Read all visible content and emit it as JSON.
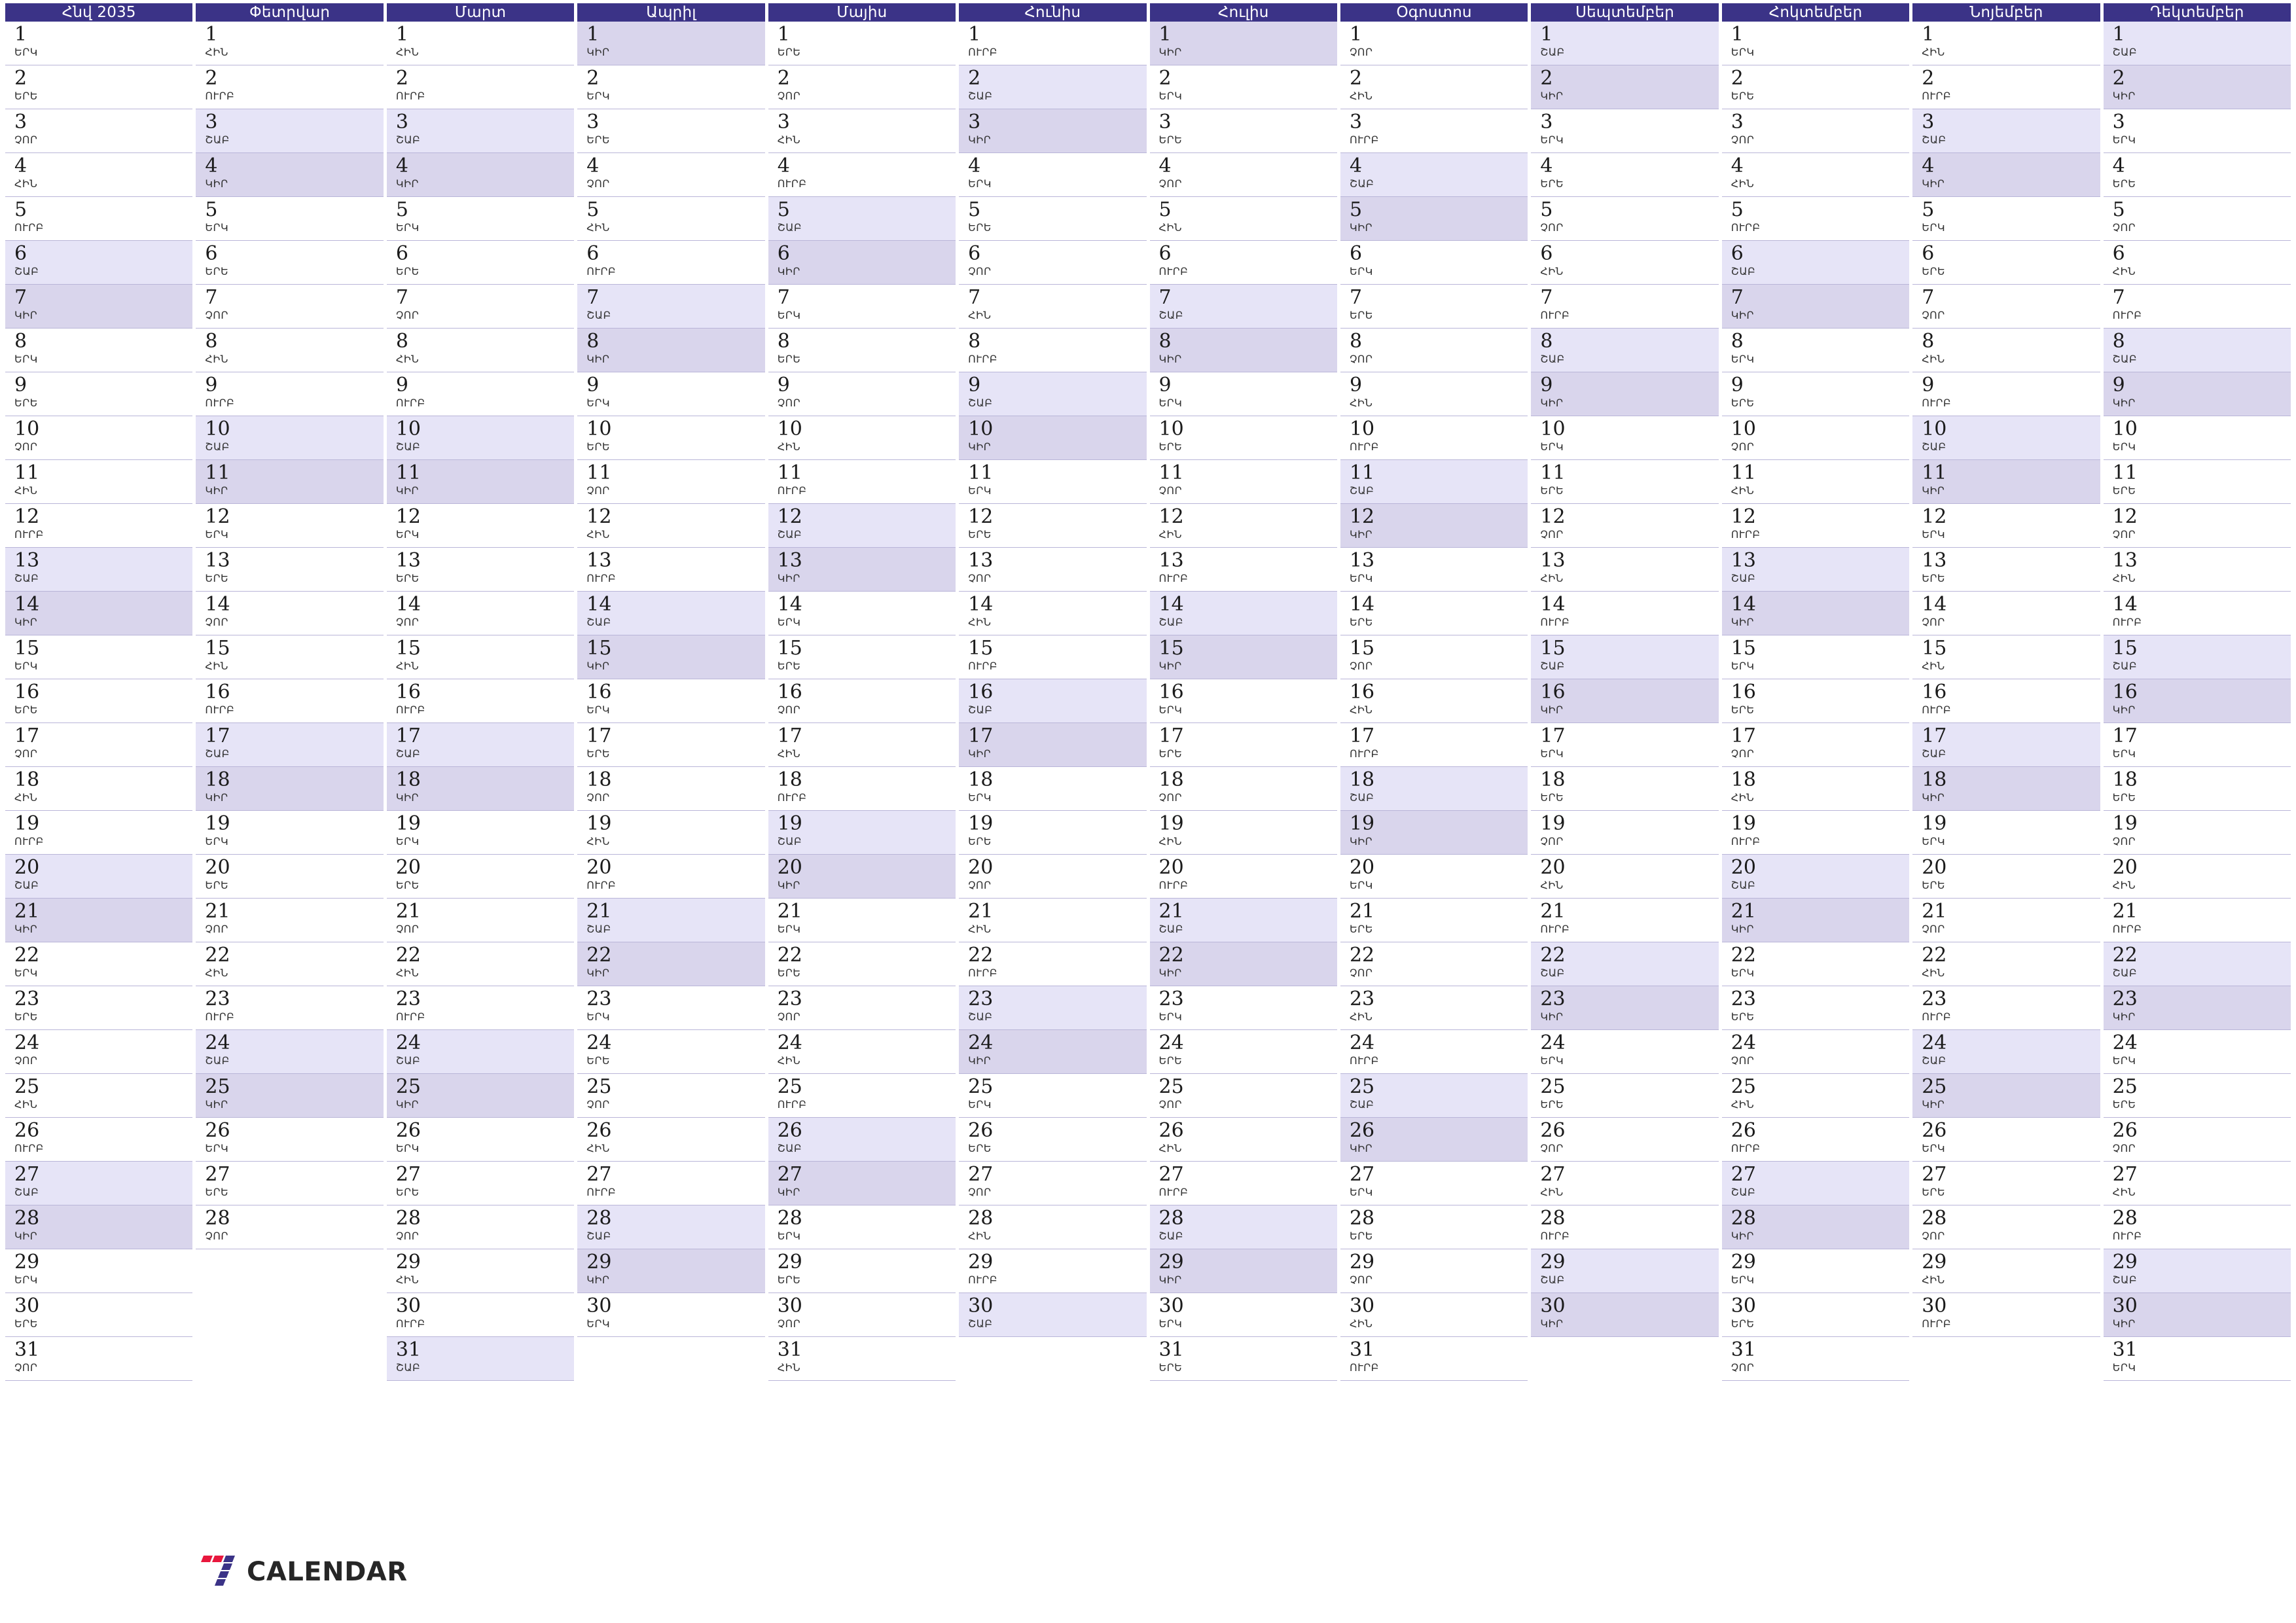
{
  "calendar": {
    "year": "2035",
    "title_first_month": "Հնվ 2035",
    "weekday_abbr": {
      "mon": "ԵՐԿ",
      "tue": "ԵՐԵ",
      "wed": "ՉՈՐ",
      "thu": "ՀԻՆ",
      "fri": "ՈՒՐԲ",
      "sat": "ՇԱԲ",
      "sun": "ԿԻՐ"
    },
    "colors": {
      "header_bg": "#3b3387",
      "header_text": "#ffffff",
      "saturday_bg": "#e6e4f7",
      "sunday_bg": "#d9d5ec",
      "row_divider": "#b9b5d8",
      "day_number": "#1b1b1b",
      "weekday_label": "#333333"
    },
    "months": [
      {
        "name": "Հնվ 2035",
        "days": 31,
        "first_weekday": 0
      },
      {
        "name": "Փետրվար",
        "days": 28,
        "first_weekday": 3
      },
      {
        "name": "Մարտ",
        "days": 31,
        "first_weekday": 3
      },
      {
        "name": "Ապրիլ",
        "days": 30,
        "first_weekday": 6
      },
      {
        "name": "Մայիս",
        "days": 31,
        "first_weekday": 1
      },
      {
        "name": "Հունիս",
        "days": 30,
        "first_weekday": 4
      },
      {
        "name": "Հուլիս",
        "days": 31,
        "first_weekday": 6
      },
      {
        "name": "Օգոստոս",
        "days": 31,
        "first_weekday": 2
      },
      {
        "name": "Սեպտեմբեր",
        "days": 30,
        "first_weekday": 5
      },
      {
        "name": "Հոկտեմբեր",
        "days": 31,
        "first_weekday": 0
      },
      {
        "name": "Նոյեմբեր",
        "days": 30,
        "first_weekday": 3
      },
      {
        "name": "Դեկտեմբեր",
        "days": 31,
        "first_weekday": 5
      }
    ]
  },
  "logo": {
    "text": "CALENDAR",
    "mark": "seven-slash-mark",
    "mark_color_top": "#e8173d",
    "mark_color_bottom": "#3b3387"
  }
}
